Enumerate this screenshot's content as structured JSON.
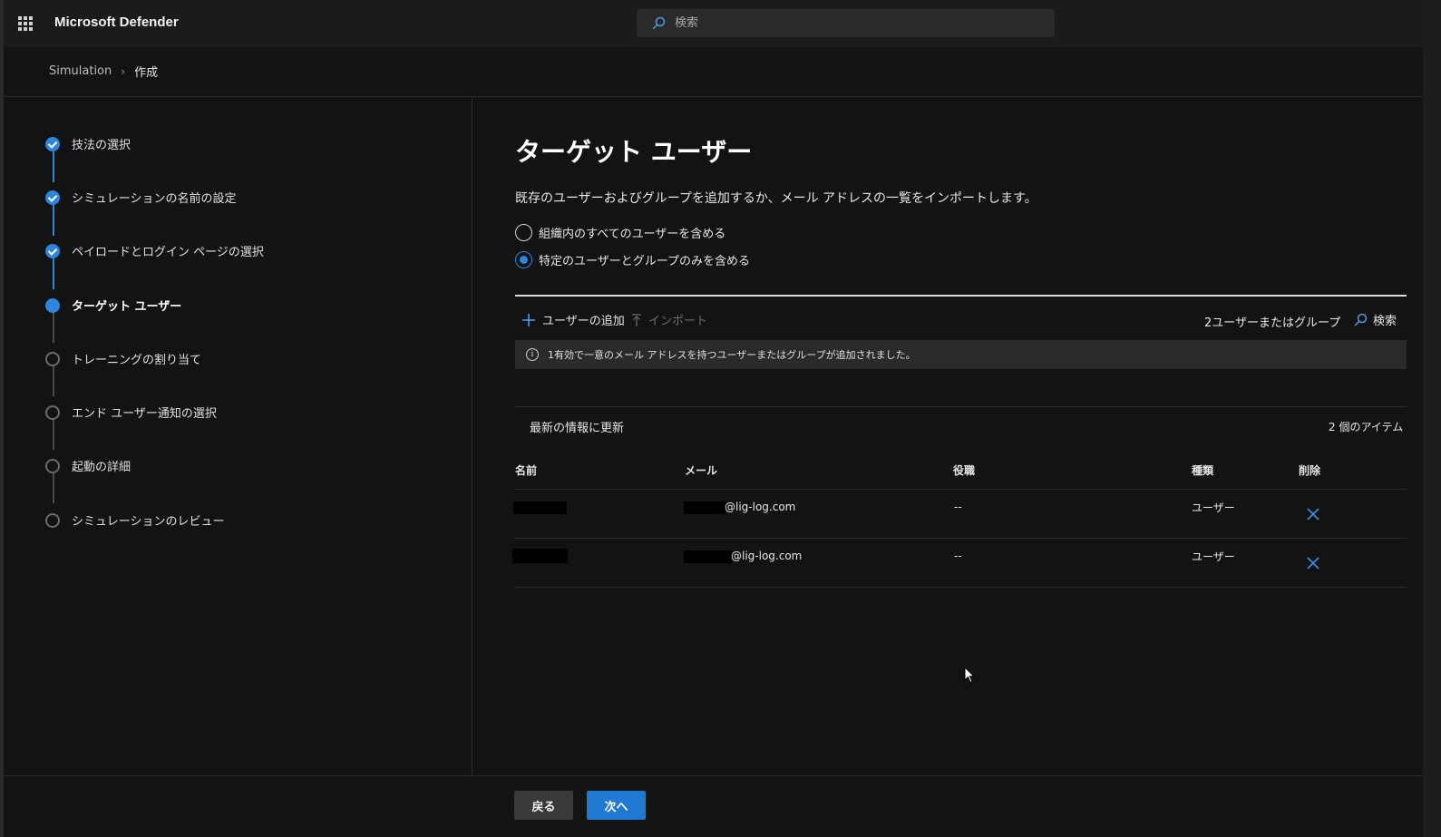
{
  "app": {
    "title": "Microsoft Defender"
  },
  "search": {
    "placeholder": "検索"
  },
  "breadcrumb": {
    "root": "Simulation",
    "current": "作成"
  },
  "steps": [
    {
      "label": "技法の選択",
      "state": "done"
    },
    {
      "label": "シミュレーションの名前の設定",
      "state": "done"
    },
    {
      "label": "ペイロードとログイン ページの選択",
      "state": "done"
    },
    {
      "label": "ターゲット ユーザー",
      "state": "current"
    },
    {
      "label": "トレーニングの割り当て",
      "state": "pending"
    },
    {
      "label": "エンド ユーザー通知の選択",
      "state": "pending"
    },
    {
      "label": "起動の詳細",
      "state": "pending"
    },
    {
      "label": "シミュレーションのレビュー",
      "state": "pending"
    }
  ],
  "main": {
    "title": "ターゲット ユーザー",
    "description": "既存のユーザーおよびグループを追加するか、メール アドレスの一覧をインポートします。",
    "radio_all": "組織内のすべてのユーザーを含める",
    "radio_specific": "特定のユーザーとグループのみを含める",
    "selected_radio": "specific"
  },
  "toolbar": {
    "add_user": "ユーザーの追加",
    "import": "インポート",
    "count": "2ユーザーまたはグループ",
    "search": "検索"
  },
  "info": {
    "message": "1有効で一意のメール アドレスを持つユーザーまたはグループが追加されました。"
  },
  "list": {
    "refresh": "最新の情報に更新",
    "item_count": "2 個のアイテム",
    "columns": {
      "name": "名前",
      "email": "メール",
      "role": "役職",
      "type": "種類",
      "delete": "削除"
    },
    "rows": [
      {
        "email": "@lig-log.com",
        "role": "--",
        "type": "ユーザー"
      },
      {
        "email": "@lig-log.com",
        "role": "--",
        "type": "ユーザー"
      }
    ]
  },
  "footer": {
    "back": "戻る",
    "next": "次へ"
  },
  "colors": {
    "accent": "#2b86e0",
    "primary_button": "#1f78d1",
    "background": "#131313"
  }
}
